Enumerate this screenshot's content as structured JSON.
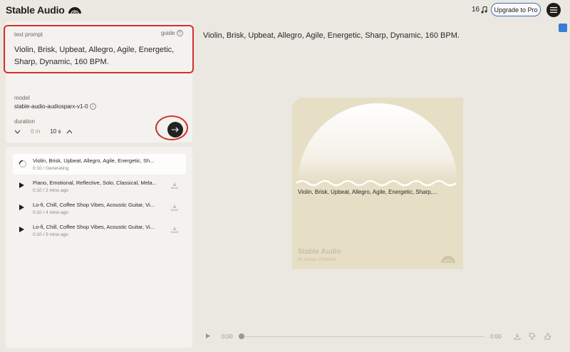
{
  "header": {
    "app_name": "Stable Audio",
    "credits": "16",
    "upgrade_label": "Upgrade to Pro",
    "icons": [
      "stable-audio-logo",
      "music-note-icon",
      "menu-icon"
    ]
  },
  "prompt_panel": {
    "label": "text prompt",
    "guide_label": "guide",
    "prompt_value": "Violin, Brisk, Upbeat, Allegro, Agile, Energetic, Sharp, Dynamic, 160 BPM."
  },
  "settings": {
    "model_label": "model",
    "model_value": "stable-audio-audiosparx-v1-0",
    "duration_label": "duration",
    "duration_start": "0 m",
    "duration_length": "10 s"
  },
  "history": [
    {
      "title": "Violin, Brisk, Upbeat, Allegro, Agile, Energetic, Sh...",
      "length": "0:10",
      "status": "Generating",
      "active": true
    },
    {
      "title": "Piano, Emotional, Reflective, Solo, Classical, Mela...",
      "length": "0:10",
      "status": "2 mins ago",
      "active": false
    },
    {
      "title": "Lo-fi, Chill, Coffee Shop Vibes, Acoustic Guitar, Vi...",
      "length": "0:10",
      "status": "4 mins ago",
      "active": false
    },
    {
      "title": "Lo-fi, Chill, Coffee Shop Vibes, Acoustic Guitar, Vi...",
      "length": "0:10",
      "status": "5 mins ago",
      "active": false
    }
  ],
  "main": {
    "title": "Violin, Brisk, Upbeat, Allegro, Agile, Energetic, Sharp, Dynamic, 160 BPM.",
    "art_caption": "Violin, Brisk, Upbeat, Allegro, Agile, Energetic, Sharp,...",
    "art_brand": "Stable Audio",
    "art_subtitle": "AI music creation"
  },
  "player": {
    "current_time": "0:00",
    "end_time": "0:00"
  },
  "colors": {
    "background": "#ebe8e2",
    "panel": "#f4f2ee",
    "art_background": "#e6dfc6",
    "accent_blue": "#3c6fb8",
    "annotation_red": "#d23030"
  }
}
